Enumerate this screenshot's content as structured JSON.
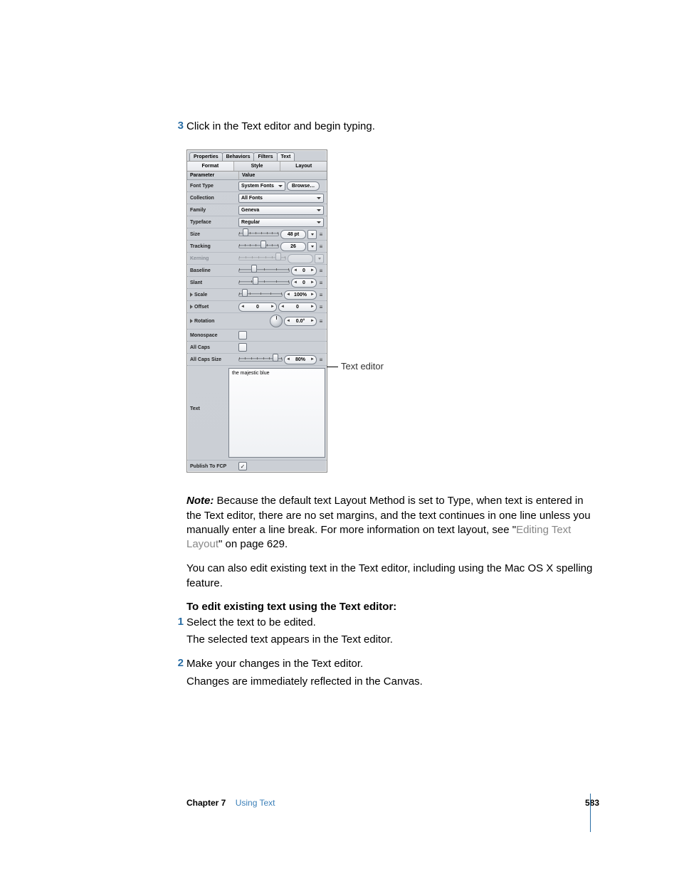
{
  "step3": {
    "num": "3",
    "text": "Click in the Text editor and begin typing."
  },
  "panel": {
    "tabs": [
      "Properties",
      "Behaviors",
      "Filters",
      "Text"
    ],
    "subtabs": [
      "Format",
      "Style",
      "Layout"
    ],
    "header_param": "Parameter",
    "header_value": "Value",
    "font_type": {
      "label": "Font Type",
      "select": "System Fonts",
      "browse": "Browse…"
    },
    "collection": {
      "label": "Collection",
      "select": "All Fonts"
    },
    "family": {
      "label": "Family",
      "select": "Geneva"
    },
    "typeface": {
      "label": "Typeface",
      "select": "Regular"
    },
    "size": {
      "label": "Size",
      "value": "48 pt"
    },
    "tracking": {
      "label": "Tracking",
      "value": "26"
    },
    "kerning": {
      "label": "Kerning",
      "value": ""
    },
    "baseline": {
      "label": "Baseline",
      "value": "0"
    },
    "slant": {
      "label": "Slant",
      "value": "0"
    },
    "scale": {
      "label": "Scale",
      "value": "100%"
    },
    "offset": {
      "label": "Offset",
      "x": "0",
      "y": "0"
    },
    "rotation": {
      "label": "Rotation",
      "value": "0.0°"
    },
    "monospace": {
      "label": "Monospace"
    },
    "allcaps": {
      "label": "All Caps"
    },
    "allcaps_size": {
      "label": "All Caps Size",
      "value": "80%"
    },
    "text_row": {
      "label": "Text",
      "content": "the majestic blue"
    },
    "publish": {
      "label": "Publish To FCP"
    }
  },
  "callout": "Text editor",
  "note": {
    "label": "Note:  ",
    "body_a": "Because the default text Layout Method is set to Type, when text is entered in the Text editor, there are no set margins, and the text continues in one line unless you manually enter a line break. For more information on text layout, see \"",
    "link": "Editing Text Layout",
    "body_b": "\" on page 629."
  },
  "para2": "You can also edit existing text in the Text editor, including using the Mac OS X spelling feature.",
  "heading": "To edit existing text using the Text editor:",
  "step1": {
    "num": "1",
    "text": "Select the text to be edited.",
    "after": "The selected text appears in the Text editor."
  },
  "step2": {
    "num": "2",
    "text": "Make your changes in the Text editor.",
    "after": "Changes are immediately reflected in the Canvas."
  },
  "footer": {
    "chapter_label": "Chapter 7",
    "chapter_title": "Using Text",
    "page": "583"
  }
}
